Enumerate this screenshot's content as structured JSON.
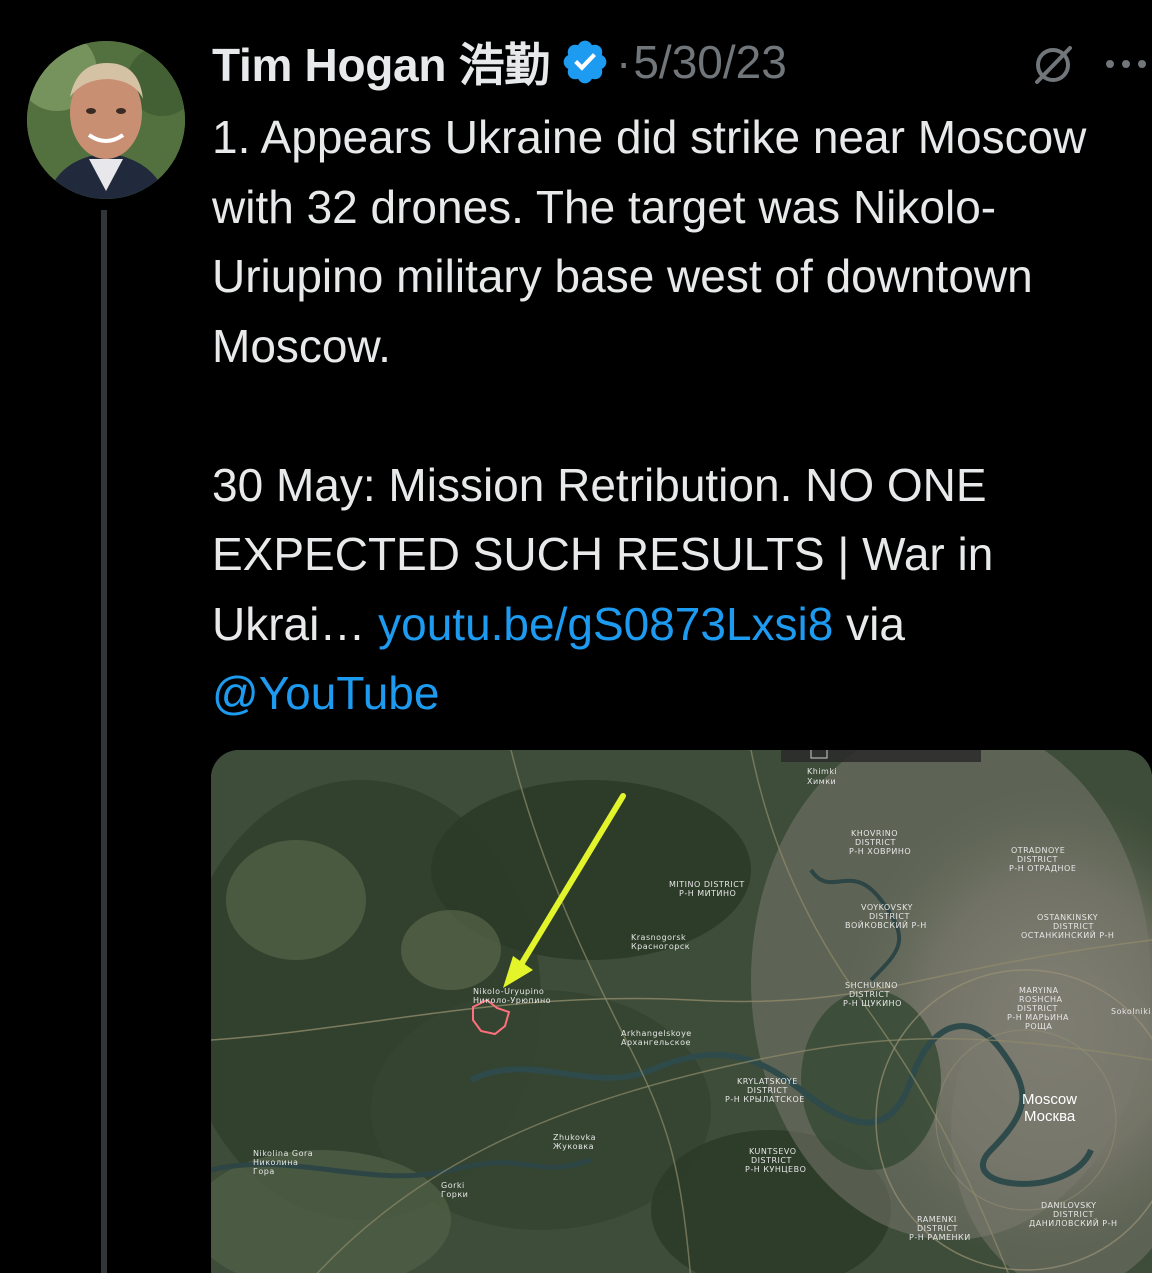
{
  "post": {
    "author_name": "Tim Hogan 浩勤",
    "separator": "·",
    "date": "5/30/23",
    "text_main": "1. Appears Ukraine did strike near Moscow with 32 drones. The target was Nikolo-Uriupino military base west of downtown Moscow.\n\n30 May: Mission Retribution. NO ONE EXPECTED SUCH RESULTS | War in Ukrai… ",
    "link_url": "youtu.be/gS0873Lxsi8",
    "text_via": " via ",
    "mention": "@YouTube"
  },
  "icons": {
    "verified": "verified-badge-icon",
    "grok": "grok-icon",
    "more": "more-options-icon"
  },
  "colors": {
    "background": "#000000",
    "text": "#e7e9ea",
    "muted": "#71767b",
    "link": "#1d9bf0",
    "verified": "#1d9bf0",
    "thread_line": "#333639",
    "arrow": "#e3f52a"
  },
  "map": {
    "labels": {
      "khimki": "Khimki\nХимки",
      "khovrino": "KHOVRINO\nDISTRICT\nР-Н ХОВРИНО",
      "otradnoye": "OTRADNOYE\nDISTRICT\nР-Н ОТРАДНОЕ",
      "mitino": "MITINO DISTRICT\nР-Н МИТИНО",
      "voykovsky": "VOYKOVSKY\nDISTRICT\nВОЙКОВСКИЙ Р-Н",
      "ostankinsky": "OSTANKINSKY\nDISTRICT\nОСТАНКИНСКИЙ Р-Н",
      "shchukino": "SHCHUKINO\nDISTRICT\nР-Н ЩУКИНО",
      "maryina": "MARYINA\nROSHCHA\nDISTRICT\nР-Н МАРЬИНА\nРОЩА",
      "krylatskoye": "KRYLATSKOYE\nDISTRICT\nР-Н КРЫЛАТСКОЕ",
      "kuntsevo": "KUNTSEVO\nDISTRICT\nР-Н КУНЦЕВО",
      "ramenki": "RAMENKI\nDISTRICT\nР-Н РАМЕНКИ",
      "danilovsky": "DANILOVSKY\nDISTRICT\nДАНИЛОВСКИЙ Р-Н",
      "moscow": "Moscow\nМосква",
      "nikolo": "Nikolo-Uryupino\nНиколо-Урюпино",
      "arkhangelskoye": "Arkhangelskoye\nАрхангельское",
      "zhukovka": "Zhukovka\nЖуковка",
      "krasnogorsk": "Krasnogorsk\nКрасногорск",
      "nikolina_gora": "Nikolina Gora\nНиколина\nГора",
      "gorki": "Gorki\nГорки",
      "sokolniki": "Sokolniki"
    }
  }
}
